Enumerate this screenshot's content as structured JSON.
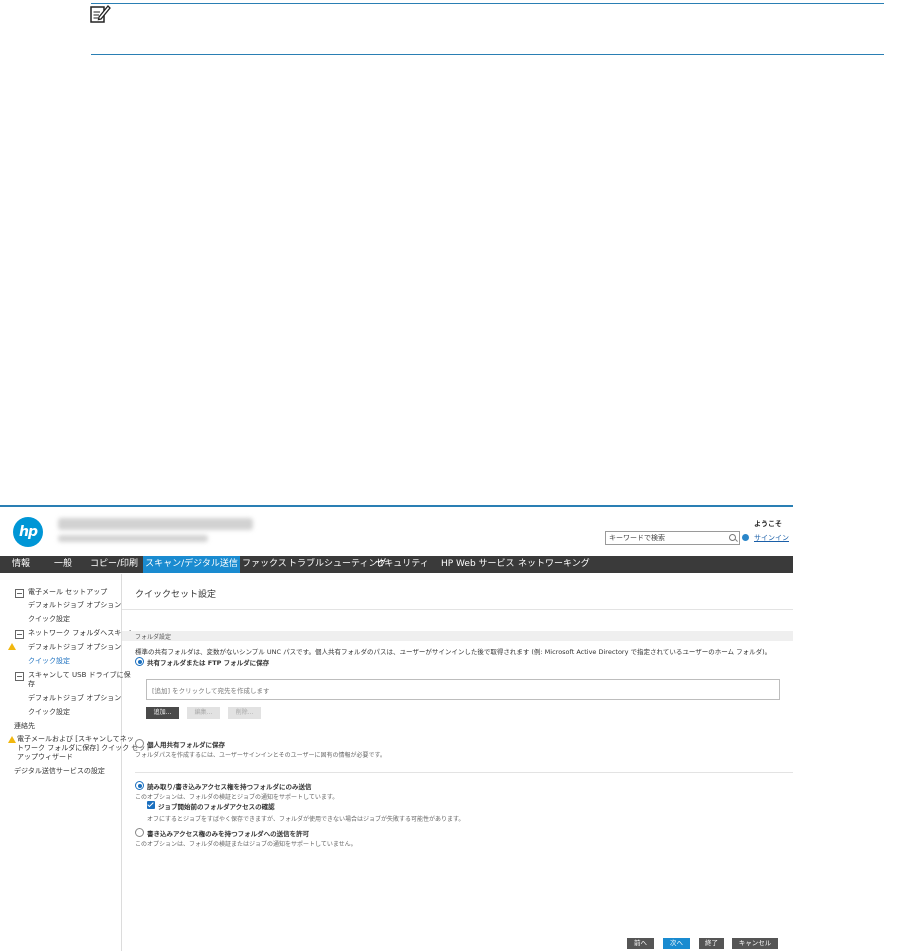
{
  "note": {
    "icon": "note-pencil-icon"
  },
  "header": {
    "logo": "hp",
    "search_placeholder": "キーワードで検索",
    "welcome": "ようこそ",
    "signin": "サインイン"
  },
  "nav": [
    {
      "label": "情報"
    },
    {
      "label": "一般"
    },
    {
      "label": "コピー/印刷"
    },
    {
      "label": "スキャン/デジタル送信",
      "active": true
    },
    {
      "label": "ファックス"
    },
    {
      "label": "トラブルシューティング"
    },
    {
      "label": "セキュリティ"
    },
    {
      "label": "HP Web サービス"
    },
    {
      "label": "ネットワーキング"
    }
  ],
  "sidebar": {
    "email_setup": "電子メール セットアップ",
    "email_default_options": "デフォルトジョブ オプション",
    "email_quick_set": "クイック設定",
    "folder_scan": "ネットワーク フォルダへスキャン",
    "folder_default_options": "デフォルトジョブ オプション",
    "folder_quick_set": "クイック設定",
    "usb_line1": "スキャンして USB ドライブに保",
    "usb_line2": "存",
    "usb_default_options": "デフォルトジョブ オプション",
    "usb_quick_set": "クイック設定",
    "contacts": "連絡先",
    "wizard_line1": "電子メールおよび [スキャンしてネッ",
    "wizard_line2": "トワーク フォルダに保存] クイック セット",
    "wizard_line3": "アップウィザード",
    "digital_send": "デジタル送信サービスの設定"
  },
  "main": {
    "title": "クイックセット設定",
    "section": "フォルダ設定",
    "intro": "標準の共有フォルダは、変数がないシンプル UNC パスです。個人共有フォルダのパスは、ユーザーがサインインした後で取得されます (例: Microsoft Active Directory で指定されているユーザーのホーム フォルダ)。",
    "opt_shared": "共有フォルダまたは FTP フォルダに保存",
    "dest_placeholder": "[追加] をクリックして宛先を作成します",
    "btn_add": "追加...",
    "btn_edit": "編集...",
    "btn_delete": "削除...",
    "opt_personal": "個人用共有フォルダに保存",
    "personal_desc": "フォルダパスを作成するには、ユーザーサインインとそのユーザーに固有の情報が必要です。",
    "opt_readwrite": "読み取り/書き込みアクセス権を持つフォルダにのみ送信",
    "readwrite_desc": "このオプションは、フォルダの検証とジョブの通知をサポートしています。",
    "verify_label": "ジョブ開始前のフォルダアクセスの確認",
    "verify_desc": "オフにするとジョブをすばやく保存できますが、フォルダが使用できない場合はジョブが失敗する可能性があります。",
    "opt_writeonly": "書き込みアクセス権のみを持つフォルダへの送信を許可",
    "writeonly_desc": "このオプションは、フォルダの検証またはジョブの通知をサポートしていません。"
  },
  "footer": {
    "prev": "前へ",
    "next": "次へ",
    "finish": "終了",
    "cancel": "キャンセル"
  }
}
